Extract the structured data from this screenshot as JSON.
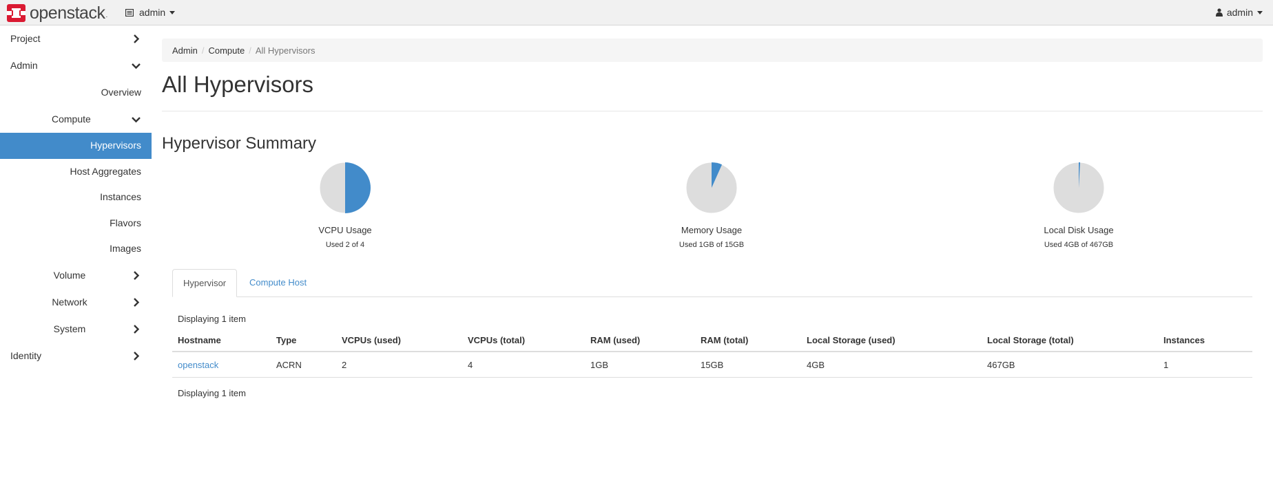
{
  "navbar": {
    "brand": "openstack",
    "brand_dot": ".",
    "project_label": "admin",
    "user_label": "admin"
  },
  "sidebar": {
    "project": "Project",
    "admin": "Admin",
    "overview": "Overview",
    "compute": "Compute",
    "hypervisors": "Hypervisors",
    "host_aggregates": "Host Aggregates",
    "instances": "Instances",
    "flavors": "Flavors",
    "images": "Images",
    "volume": "Volume",
    "network": "Network",
    "system": "System",
    "identity": "Identity"
  },
  "breadcrumb": {
    "admin": "Admin",
    "compute": "Compute",
    "current": "All Hypervisors",
    "separator": "/"
  },
  "page_title": "All Hypervisors",
  "summary": {
    "title": "Hypervisor Summary",
    "charts": [
      {
        "label": "VCPU Usage",
        "sub": "Used 2 of 4",
        "used": 2,
        "total": 4
      },
      {
        "label": "Memory Usage",
        "sub": "Used 1GB of 15GB",
        "used": 1,
        "total": 15
      },
      {
        "label": "Local Disk Usage",
        "sub": "Used 4GB of 467GB",
        "used": 4,
        "total": 467
      }
    ]
  },
  "tabs": {
    "hypervisor": "Hypervisor",
    "compute_host": "Compute Host"
  },
  "table": {
    "count_text": "Displaying 1 item",
    "headers": [
      "Hostname",
      "Type",
      "VCPUs (used)",
      "VCPUs (total)",
      "RAM (used)",
      "RAM (total)",
      "Local Storage (used)",
      "Local Storage (total)",
      "Instances"
    ],
    "rows": [
      [
        "openstack",
        "ACRN",
        "2",
        "4",
        "1GB",
        "15GB",
        "4GB",
        "467GB",
        "1"
      ]
    ]
  },
  "colors": {
    "accent": "#428bca",
    "pie_bg": "#dddddd"
  }
}
